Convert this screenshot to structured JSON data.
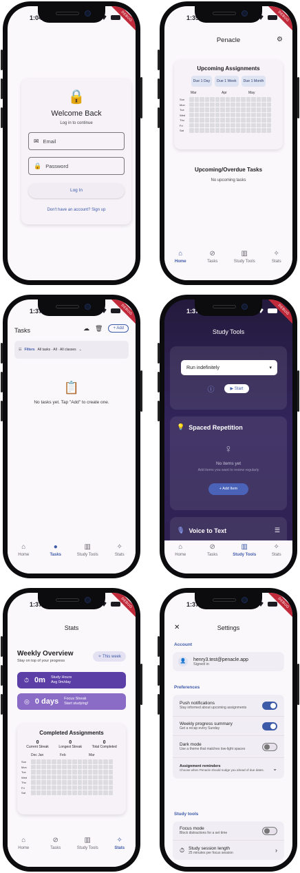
{
  "status": {
    "login": "1:04",
    "home": "1:35",
    "tasks": "1:37",
    "study": "1:37",
    "stats": "1:37",
    "settings": "1:37"
  },
  "ribbon": "DEBUG",
  "nav": {
    "home": "Home",
    "tasks": "Tasks",
    "study": "Study Tools",
    "stats": "Stats"
  },
  "login": {
    "title": "Welcome Back",
    "subtitle": "Log in to continue",
    "email_placeholder": "Email",
    "password_placeholder": "Password",
    "login_button": "Log In",
    "signup_link": "Don't have an account? Sign up"
  },
  "home": {
    "app_title": "Penacle",
    "upcoming_title": "Upcoming Assignments",
    "chips": [
      "Due 1 Day",
      "Due 1 Week",
      "Due 1 Month"
    ],
    "months": [
      "Mar",
      "Apr",
      "May"
    ],
    "days": [
      "Sun",
      "Mon",
      "Tue",
      "Wed",
      "Thu",
      "Fri",
      "Sat"
    ],
    "overdue_title": "Upcoming/Overdue Tasks",
    "overdue_empty": "No upcoming tasks"
  },
  "tasks": {
    "title": "Tasks",
    "add_label": "+ Add",
    "filters_label": "Filters",
    "filters_value": "All tasks · All · All classes",
    "empty_text": "No tasks yet. Tap \"Add\" to create one."
  },
  "study": {
    "title": "Study Tools",
    "timer_mode": "Run indefinitely",
    "start_label": "Start",
    "spaced_title": "Spaced Repetition",
    "no_items": "No items yet",
    "no_items_sub": "Add items you want to review regularly",
    "add_item": "+ Add Item",
    "voice_title": "Voice to Text"
  },
  "stats": {
    "title": "Stats",
    "weekly_title": "Weekly Overview",
    "weekly_sub": "Stay on top of your progress",
    "week_chip": "This week",
    "study_hours_value": "0m",
    "study_hours_label": "Study Hours",
    "study_hours_sub": "Avg 0m/day",
    "focus_value": "0 days",
    "focus_label": "Focus Streak",
    "focus_sub": "Start studying!",
    "completed_title": "Completed Assignments",
    "current_streak_value": "0",
    "current_streak_label": "Current Streak",
    "longest_streak_value": "0",
    "longest_streak_label": "Longest Streak",
    "total_value": "0",
    "total_label": "Total Completed",
    "months": [
      "Dec Jan",
      "Feb",
      "Mar"
    ],
    "days": [
      "Sun",
      "Mon",
      "Tue",
      "Wed",
      "Thu",
      "Fri",
      "Sat"
    ]
  },
  "settings": {
    "title": "Settings",
    "account_label": "Account",
    "email": "henry3.test@penacle.app",
    "signed_in": "Signed in",
    "prefs_label": "Preferences",
    "push_title": "Push notifications",
    "push_desc": "Stay informed about upcoming assignments",
    "weekly_title": "Weekly progress summary",
    "weekly_desc": "Get a recap every Sunday",
    "dark_title": "Dark mode",
    "dark_desc": "Use a theme that matches low-light spaces",
    "reminders_title": "Assignment reminders",
    "reminders_desc": "Choose when Penacle should nudge you ahead of due dates.",
    "study_tools_label": "Study tools",
    "focus_title": "Focus mode",
    "focus_desc": "Block distractions for a set time",
    "session_title": "Study session length",
    "session_desc": "25 minutes per focus session"
  },
  "toggles": {
    "push": true,
    "weekly": true,
    "dark": false,
    "focus": false
  },
  "colors": {
    "accent": "#3d5aa8",
    "study_bg": "#2e2150",
    "bar_primary": "#5b3ea6",
    "bar_secondary": "#8a6bc6"
  }
}
